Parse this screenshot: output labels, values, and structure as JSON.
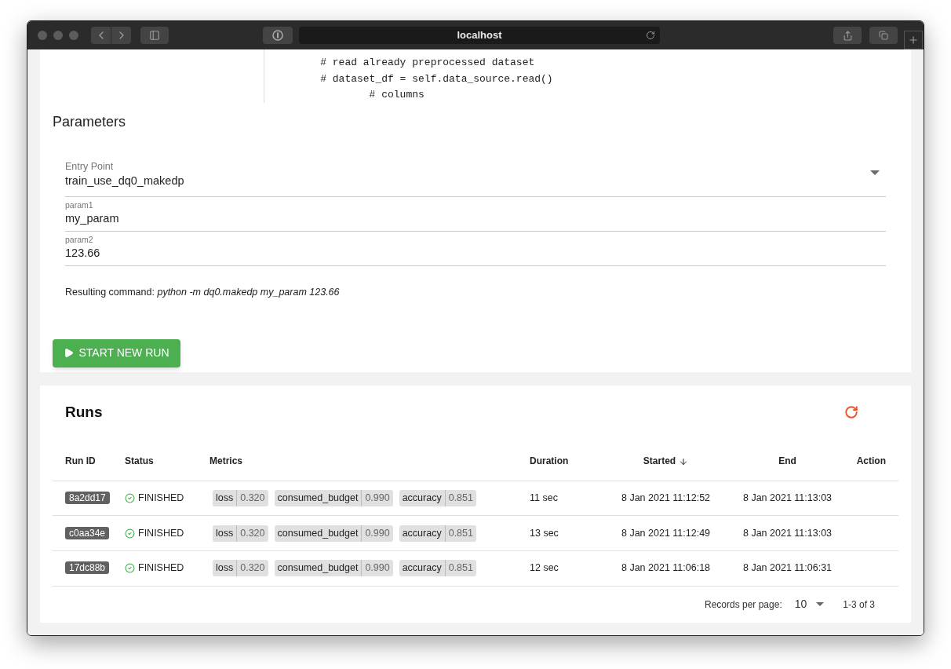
{
  "browser": {
    "address": "localhost"
  },
  "code_lines": [
    "    # read already preprocessed dataset",
    "    # dataset_df = self.data_source.read()",
    "            # columns"
  ],
  "parameters": {
    "title": "Parameters",
    "fields": [
      {
        "kind": "select",
        "label": "Entry Point",
        "value": "train_use_dq0_makedp"
      },
      {
        "kind": "text",
        "label": "param1",
        "value": "my_param"
      },
      {
        "kind": "text",
        "label": "param2",
        "value": "123.66"
      }
    ],
    "command_label": "Resulting command:",
    "command": "python -m dq0.makedp my_param 123.66"
  },
  "start_button": "START NEW RUN",
  "runs": {
    "title": "Runs",
    "columns": [
      {
        "label": "Run ID",
        "sorted": false
      },
      {
        "label": "Status",
        "sorted": false
      },
      {
        "label": "Metrics",
        "sorted": false
      },
      {
        "label": "Duration",
        "sorted": false
      },
      {
        "label": "Started",
        "sorted": true
      },
      {
        "label": "End",
        "sorted": false
      },
      {
        "label": "Action",
        "sorted": false
      }
    ],
    "rows": [
      {
        "id": "8a2dd17",
        "status": "FINISHED",
        "metrics": [
          {
            "name": "loss",
            "value": "0.320"
          },
          {
            "name": "consumed_budget",
            "value": "0.990"
          },
          {
            "name": "accuracy",
            "value": "0.851"
          }
        ],
        "duration": "11 sec",
        "started": "8 Jan 2021 11:12:52",
        "end": "8 Jan 2021 11:13:03"
      },
      {
        "id": "c0aa34e",
        "status": "FINISHED",
        "metrics": [
          {
            "name": "loss",
            "value": "0.320"
          },
          {
            "name": "consumed_budget",
            "value": "0.990"
          },
          {
            "name": "accuracy",
            "value": "0.851"
          }
        ],
        "duration": "13 sec",
        "started": "8 Jan 2021 11:12:49",
        "end": "8 Jan 2021 11:13:03"
      },
      {
        "id": "17dc88b",
        "status": "FINISHED",
        "metrics": [
          {
            "name": "loss",
            "value": "0.320"
          },
          {
            "name": "consumed_budget",
            "value": "0.990"
          },
          {
            "name": "accuracy",
            "value": "0.851"
          }
        ],
        "duration": "12 sec",
        "started": "8 Jan 2021 11:06:18",
        "end": "8 Jan 2021 11:06:31"
      }
    ],
    "pagination": {
      "label": "Records per page:",
      "per_page": "10",
      "range": "1-3 of 3"
    }
  }
}
